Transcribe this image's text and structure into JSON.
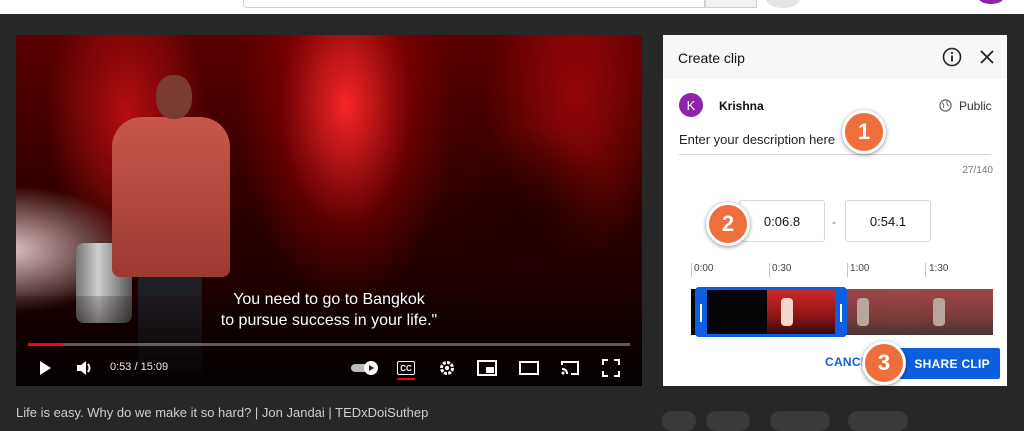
{
  "video": {
    "caption_line1": "You need to go to Bangkok",
    "caption_line2": "to pursue success in your life.\"",
    "progress": 0.058,
    "time_current": "0:53",
    "time_separator": "/",
    "time_total": "15:09",
    "title": "Life is easy. Why do we make it so hard? | Jon Jandai | TEDxDoiSuthep"
  },
  "controls": {
    "cc_label": "CC"
  },
  "clip_panel": {
    "title": "Create clip",
    "user_initial": "K",
    "username": "Krishna",
    "privacy": "Public",
    "description_placeholder": "Enter your description here",
    "char_counter": "27/140",
    "start_time": "0:06.8",
    "time_dash": "-",
    "end_time": "0:54.1",
    "timeline_ticks": [
      "0:00",
      "0:30",
      "1:00",
      "1:30"
    ],
    "cancel_label": "CANCEL",
    "share_label": "SHARE CLIP"
  },
  "annotations": {
    "step1": "1",
    "step2": "2",
    "step3": "3"
  },
  "colors": {
    "accent_blue": "#0d5fe0",
    "badge_orange": "#ef6f3c",
    "progress_red": "#ff0000",
    "avatar_purple": "#8e24aa"
  }
}
